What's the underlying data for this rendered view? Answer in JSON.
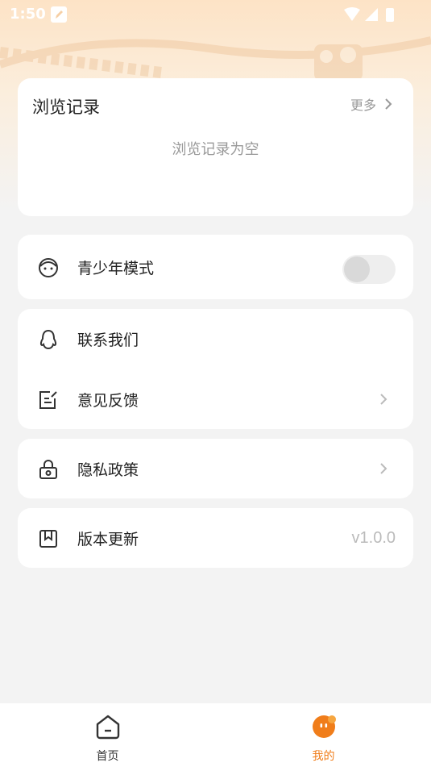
{
  "status_bar": {
    "time": "1:50"
  },
  "history": {
    "title": "浏览记录",
    "more_label": "更多",
    "empty_text": "浏览记录为空"
  },
  "teen_mode": {
    "label": "青少年模式",
    "enabled": false
  },
  "contact": {
    "label": "联系我们"
  },
  "feedback": {
    "label": "意见反馈"
  },
  "privacy": {
    "label": "隐私政策"
  },
  "version": {
    "label": "版本更新",
    "value": "v1.0.0"
  },
  "tabbar": {
    "home_label": "首页",
    "mine_label": "我的",
    "active_color": "#f07d1a",
    "inactive_color": "#333333"
  }
}
